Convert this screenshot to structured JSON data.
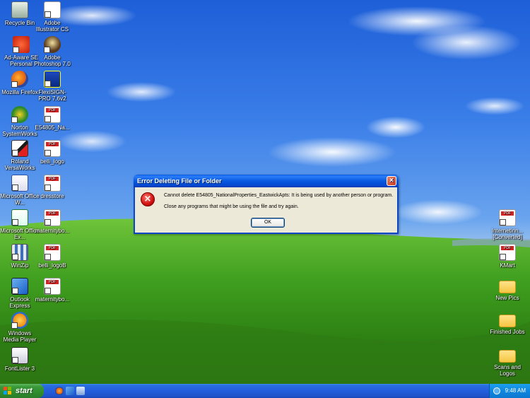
{
  "desktop": {
    "left_icons": [
      {
        "label": "Recycle Bin",
        "name": "recycle-bin-icon"
      },
      {
        "label": "Adobe Illustrator CS",
        "name": "adobe-illustrator-icon"
      },
      {
        "label": "Ad-Aware SE Personal",
        "name": "ad-aware-icon"
      },
      {
        "label": "Adobe Photoshop 7.0",
        "name": "adobe-photoshop-icon"
      },
      {
        "label": "Mozilla Firefox",
        "name": "firefox-icon"
      },
      {
        "label": "FlexiSIGN-PRO 7.6v2",
        "name": "flexisign-icon"
      },
      {
        "label": "Norton SystemWorks",
        "name": "norton-icon"
      },
      {
        "label": "E54805_Na...",
        "name": "pdf-file-icon"
      },
      {
        "label": "Roland VersaWorks",
        "name": "roland-icon"
      },
      {
        "label": "belli_logo",
        "name": "pdf-file-icon"
      },
      {
        "label": "Microsoft Office W...",
        "name": "word-icon"
      },
      {
        "label": "dresstore",
        "name": "pdf-file-icon"
      },
      {
        "label": "Microsoft Office Ex...",
        "name": "excel-icon"
      },
      {
        "label": "maternitybo...",
        "name": "pdf-file-icon"
      },
      {
        "label": "WinZip",
        "name": "winzip-icon"
      },
      {
        "label": "belli_logoB",
        "name": "pdf-file-icon"
      },
      {
        "label": "Outlook Express",
        "name": "outlook-express-icon"
      },
      {
        "label": "maternitybo...",
        "name": "pdf-file-icon"
      },
      {
        "label": "Windows Media Player",
        "name": "media-player-icon"
      },
      {
        "label": "FontLister 3",
        "name": "fontlister-icon"
      }
    ],
    "right_icons": [
      {
        "label": "Internetinn... [Converted]",
        "name": "pdf-file-icon"
      },
      {
        "label": "KMart",
        "name": "pdf-file-icon"
      },
      {
        "label": "New Pics",
        "name": "folder-icon"
      },
      {
        "label": "Finished Jobs",
        "name": "folder-icon"
      },
      {
        "label": "Scans and Logos",
        "name": "folder-icon"
      }
    ]
  },
  "dialog": {
    "title": "Error Deleting File or Folder",
    "message1": "Cannot delete E54805_NationalProperties_EastwickApts: It is being used by another person or program.",
    "message2": "Close any programs that might be using the file and try again.",
    "ok_label": "OK",
    "close_glyph": "×",
    "error_glyph": "×"
  },
  "taskbar": {
    "start_label": "start",
    "clock": "9:48 AM"
  },
  "colors": {
    "titlebar": "#0a5de8",
    "taskbar": "#245edb",
    "start_button": "#3a9a3a",
    "error_red": "#d01010"
  }
}
